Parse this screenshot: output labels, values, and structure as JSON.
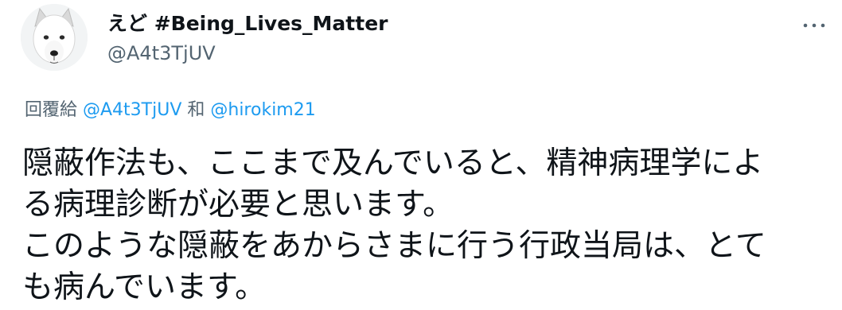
{
  "tweet": {
    "author": {
      "display_name": "えど #Being_Lives_Matter",
      "handle": "@A4t3TjUV",
      "avatar_icon": "white-dog-avatar-icon"
    },
    "more_icon": "more-options-icon",
    "reply": {
      "prefix": "回覆給 ",
      "mention_1": "@A4t3TjUV",
      "connector": " 和 ",
      "mention_2": "@hirokim21"
    },
    "text_lines": [
      "隠蔽作法も、ここまで及んでいると、精神病理学によ",
      "る病理診断が必要と思います。",
      "このような隠蔽をあからさまに行う行政当局は、とて",
      "も病んでいます。"
    ],
    "colors": {
      "link": "#1d9bf0",
      "secondary_text": "#536471",
      "primary_text": "#0f1419"
    }
  }
}
